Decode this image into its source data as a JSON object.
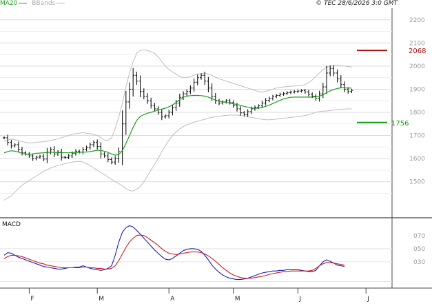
{
  "header": {
    "legend": [
      {
        "label": "MA20",
        "color": "#1e9c1e"
      },
      {
        "label": "BBands",
        "color": "#bbbbbb"
      }
    ],
    "copyright": "© TEC 28/6/2026 3:0 GMT"
  },
  "chart_data": [
    {
      "type": "ohlc",
      "title": "",
      "ylim": [
        1350,
        2250
      ],
      "y_ticks": [
        {
          "value": 1500,
          "label": "1500"
        },
        {
          "value": 1600,
          "label": "1600"
        },
        {
          "value": 1700,
          "label": "1700"
        },
        {
          "value": 1800,
          "label": "1800"
        },
        {
          "value": 1900,
          "label": "1900"
        },
        {
          "value": 2000,
          "label": "2000"
        },
        {
          "value": 2100,
          "label": "2100"
        },
        {
          "value": 2200,
          "label": "2200"
        }
      ],
      "x_labels": [
        "F",
        "M",
        "A",
        "M",
        "J",
        "J"
      ],
      "price_series": [
        1690,
        1670,
        1655,
        1660,
        1640,
        1625,
        1620,
        1612,
        1600,
        1606,
        1610,
        1598,
        1628,
        1640,
        1620,
        1628,
        1606,
        1605,
        1612,
        1622,
        1632,
        1628,
        1640,
        1648,
        1660,
        1670,
        1652,
        1620,
        1612,
        1596,
        1585,
        1600,
        1630,
        1750,
        1845,
        1900,
        1960,
        1935,
        1890,
        1870,
        1850,
        1830,
        1815,
        1800,
        1780,
        1785,
        1800,
        1820,
        1840,
        1865,
        1880,
        1890,
        1905,
        1930,
        1950,
        1960,
        1935,
        1905,
        1870,
        1850,
        1840,
        1845,
        1850,
        1842,
        1830,
        1815,
        1798,
        1790,
        1803,
        1815,
        1822,
        1828,
        1840,
        1852,
        1860,
        1868,
        1873,
        1878,
        1882,
        1885,
        1888,
        1890,
        1892,
        1894,
        1888,
        1878,
        1870,
        1860,
        1880,
        1910,
        1970,
        1990,
        1970,
        1945,
        1920,
        1900,
        1890,
        1895
      ],
      "ma20": [
        1625,
        1630,
        1634,
        1632,
        1628,
        1623,
        1619,
        1618,
        1620,
        1623,
        1624,
        1625,
        1626,
        1628,
        1627,
        1626,
        1626,
        1625,
        1625,
        1626,
        1627,
        1627,
        1628,
        1628,
        1630,
        1633,
        1636,
        1635,
        1632,
        1627,
        1620,
        1615,
        1618,
        1635,
        1665,
        1700,
        1735,
        1765,
        1782,
        1790,
        1796,
        1800,
        1805,
        1810,
        1814,
        1818,
        1824,
        1832,
        1843,
        1855,
        1865,
        1870,
        1872,
        1873,
        1873,
        1872,
        1870,
        1866,
        1860,
        1853,
        1848,
        1845,
        1843,
        1840,
        1837,
        1834,
        1830,
        1826,
        1822,
        1819,
        1818,
        1818,
        1821,
        1826,
        1831,
        1838,
        1845,
        1852,
        1858,
        1862,
        1865,
        1866,
        1866,
        1866,
        1866,
        1866,
        1866,
        1867,
        1870,
        1876,
        1885,
        1893,
        1899,
        1903,
        1906,
        1906,
        1905,
        1905
      ],
      "bbands_upper": [
        1675,
        1680,
        1685,
        1682,
        1678,
        1674,
        1670,
        1667,
        1668,
        1670,
        1672,
        1673,
        1675,
        1678,
        1682,
        1686,
        1690,
        1695,
        1700,
        1705,
        1708,
        1710,
        1712,
        1710,
        1708,
        1705,
        1700,
        1690,
        1680,
        1678,
        1690,
        1730,
        1780,
        1840,
        1910,
        1970,
        2020,
        2055,
        2068,
        2070,
        2068,
        2062,
        2055,
        2040,
        2020,
        2000,
        1985,
        1975,
        1965,
        1955,
        1950,
        1950,
        1955,
        1960,
        1965,
        1968,
        1968,
        1965,
        1960,
        1952,
        1945,
        1940,
        1935,
        1930,
        1925,
        1920,
        1915,
        1910,
        1905,
        1900,
        1895,
        1890,
        1888,
        1890,
        1895,
        1900,
        1905,
        1908,
        1910,
        1912,
        1913,
        1914,
        1915,
        1916,
        1920,
        1928,
        1940,
        1955,
        1970,
        1985,
        1995,
        2000,
        2003,
        2003,
        2002,
        2000,
        1998,
        1996
      ],
      "bbands_lower": [
        1420,
        1430,
        1440,
        1455,
        1470,
        1485,
        1495,
        1505,
        1515,
        1525,
        1535,
        1545,
        1552,
        1560,
        1565,
        1570,
        1574,
        1578,
        1582,
        1585,
        1587,
        1588,
        1585,
        1578,
        1570,
        1560,
        1550,
        1540,
        1530,
        1520,
        1510,
        1500,
        1492,
        1482,
        1470,
        1462,
        1460,
        1468,
        1480,
        1500,
        1525,
        1550,
        1575,
        1600,
        1630,
        1655,
        1680,
        1700,
        1715,
        1728,
        1738,
        1746,
        1752,
        1758,
        1762,
        1766,
        1770,
        1775,
        1778,
        1781,
        1783,
        1785,
        1787,
        1788,
        1788,
        1788,
        1786,
        1784,
        1781,
        1778,
        1776,
        1773,
        1770,
        1768,
        1768,
        1769,
        1771,
        1773,
        1775,
        1776,
        1778,
        1780,
        1782,
        1784,
        1786,
        1790,
        1795,
        1800,
        1803,
        1805,
        1806,
        1808,
        1810,
        1812,
        1813,
        1814,
        1815,
        1815
      ]
    },
    {
      "type": "line",
      "title": "MACD",
      "ylim": [
        -0.1,
        0.95
      ],
      "y_ticks": [
        {
          "value": 0.3,
          "label": "030"
        },
        {
          "value": 0.5,
          "label": "050"
        },
        {
          "value": 0.7,
          "label": "070"
        }
      ],
      "series": [
        {
          "name": "",
          "color": "#1d1db4",
          "values": [
            0.4,
            0.44,
            0.43,
            0.4,
            0.37,
            0.35,
            0.33,
            0.31,
            0.29,
            0.27,
            0.25,
            0.23,
            0.22,
            0.21,
            0.2,
            0.19,
            0.19,
            0.2,
            0.21,
            0.21,
            0.22,
            0.22,
            0.24,
            0.22,
            0.2,
            0.19,
            0.18,
            0.17,
            0.18,
            0.2,
            0.24,
            0.4,
            0.6,
            0.75,
            0.82,
            0.85,
            0.83,
            0.78,
            0.72,
            0.66,
            0.6,
            0.54,
            0.48,
            0.43,
            0.38,
            0.34,
            0.33,
            0.35,
            0.39,
            0.43,
            0.47,
            0.49,
            0.5,
            0.5,
            0.49,
            0.46,
            0.4,
            0.33,
            0.25,
            0.19,
            0.14,
            0.1,
            0.07,
            0.05,
            0.04,
            0.03,
            0.03,
            0.04,
            0.05,
            0.07,
            0.09,
            0.11,
            0.13,
            0.14,
            0.15,
            0.16,
            0.16,
            0.17,
            0.17,
            0.18,
            0.18,
            0.18,
            0.18,
            0.17,
            0.16,
            0.15,
            0.15,
            0.17,
            0.24,
            0.3,
            0.33,
            0.31,
            0.28,
            0.25,
            0.24,
            0.23
          ]
        },
        {
          "name": "",
          "color": "#d11a1a",
          "values": [
            0.35,
            0.38,
            0.4,
            0.4,
            0.39,
            0.38,
            0.36,
            0.34,
            0.32,
            0.3,
            0.28,
            0.27,
            0.25,
            0.24,
            0.23,
            0.22,
            0.21,
            0.21,
            0.21,
            0.21,
            0.21,
            0.21,
            0.22,
            0.22,
            0.21,
            0.21,
            0.2,
            0.2,
            0.19,
            0.19,
            0.2,
            0.24,
            0.32,
            0.42,
            0.52,
            0.6,
            0.66,
            0.7,
            0.71,
            0.7,
            0.67,
            0.63,
            0.59,
            0.55,
            0.5,
            0.46,
            0.43,
            0.42,
            0.41,
            0.42,
            0.43,
            0.44,
            0.45,
            0.45,
            0.45,
            0.44,
            0.42,
            0.39,
            0.35,
            0.31,
            0.26,
            0.21,
            0.17,
            0.13,
            0.1,
            0.08,
            0.06,
            0.05,
            0.05,
            0.05,
            0.06,
            0.07,
            0.08,
            0.09,
            0.11,
            0.12,
            0.13,
            0.14,
            0.15,
            0.15,
            0.16,
            0.16,
            0.16,
            0.16,
            0.16,
            0.16,
            0.17,
            0.2,
            0.24,
            0.27,
            0.29,
            0.29,
            0.28,
            0.27,
            0.26,
            0.25
          ]
        }
      ]
    }
  ],
  "levels": [
    {
      "value": 2068,
      "label": "2068",
      "color": "#b01010"
    },
    {
      "value": 1756,
      "label": "1756",
      "color": "#119911"
    }
  ]
}
